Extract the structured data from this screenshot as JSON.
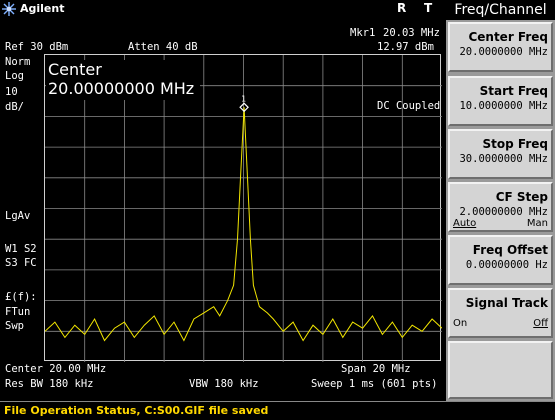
{
  "header": {
    "brand": "Agilent",
    "r_indicator": "R",
    "t_indicator": "T"
  },
  "marker": {
    "label": "Mkr1",
    "freq": "20.03 MHz",
    "ampl": "12.97 dBm",
    "number": "1"
  },
  "settings": {
    "ref": "Ref 30 dBm",
    "atten": "Atten 40 dB",
    "scale_lines": [
      "Norm",
      "Log",
      "10",
      "dB/"
    ],
    "lgav": "LgAv",
    "w1s2": "W1  S2",
    "s3fc": "S3  FC",
    "ff": "£(f):",
    "ftun": "FTun",
    "swp": "Swp",
    "coupling": "DC Coupled"
  },
  "active_function": {
    "label": "Center",
    "value": "20.00000000 MHz"
  },
  "footer": {
    "center": "Center 20.00 MHz",
    "span": "Span 20 MHz",
    "res_bw": "Res BW 180 kHz",
    "vbw": "VBW 180 kHz",
    "sweep": "Sweep 1 ms (601 pts)"
  },
  "status": {
    "text": "File Operation Status, C:S00.GIF file saved"
  },
  "menu": {
    "title": "Freq/Channel",
    "keys": [
      {
        "label": "Center Freq",
        "value": "20.0000000 MHz"
      },
      {
        "label": "Start Freq",
        "value": "10.0000000 MHz"
      },
      {
        "label": "Stop Freq",
        "value": "30.0000000 MHz"
      },
      {
        "label": "CF Step",
        "value": "2.00000000 MHz",
        "left": "Auto",
        "right": "Man"
      },
      {
        "label": "Freq Offset",
        "value": "0.00000000  Hz"
      },
      {
        "label": "Signal Track",
        "left": "On",
        "right": "Off"
      },
      {
        "label": ""
      }
    ]
  },
  "colors": {
    "trace": "#f2e600",
    "marker": "#ffffff",
    "softkey_bg": "#d4d4d4",
    "status_text": "#ffd800"
  },
  "icons": {
    "brand": "agilent-spark-icon",
    "marker": "marker-diamond-icon"
  },
  "chart_data": {
    "type": "line",
    "x_unit": "MHz",
    "y_unit": "dBm",
    "xlim": [
      10,
      30
    ],
    "ylim": [
      -70,
      30
    ],
    "grid": true,
    "series": [
      {
        "x": [
          10.0,
          10.5,
          11.0,
          11.5,
          12.0,
          12.5,
          13.0,
          13.5,
          14.0,
          14.5,
          15.0,
          15.5,
          16.0,
          16.5,
          17.0,
          17.5,
          18.0,
          18.5,
          18.8,
          19.2,
          19.5,
          19.7,
          19.85,
          20.03,
          20.2,
          20.35,
          20.5,
          20.8,
          21.2,
          21.5,
          22.0,
          22.5,
          23.0,
          23.5,
          24.0,
          24.5,
          25.0,
          25.5,
          26.0,
          26.5,
          27.0,
          27.5,
          28.0,
          28.5,
          29.0,
          29.5,
          30.0
        ],
        "y": [
          -60,
          -57,
          -62,
          -58,
          -61,
          -56,
          -63,
          -59,
          -57,
          -62,
          -58,
          -55,
          -61,
          -57,
          -63,
          -56,
          -54,
          -52,
          -55,
          -50,
          -45,
          -30,
          -10,
          12.97,
          -10,
          -30,
          -45,
          -52,
          -54,
          -56,
          -60,
          -57,
          -63,
          -58,
          -61,
          -56,
          -62,
          -57,
          -59,
          -55,
          -61,
          -57,
          -62,
          -58,
          -60,
          -56,
          -59
        ]
      }
    ]
  }
}
